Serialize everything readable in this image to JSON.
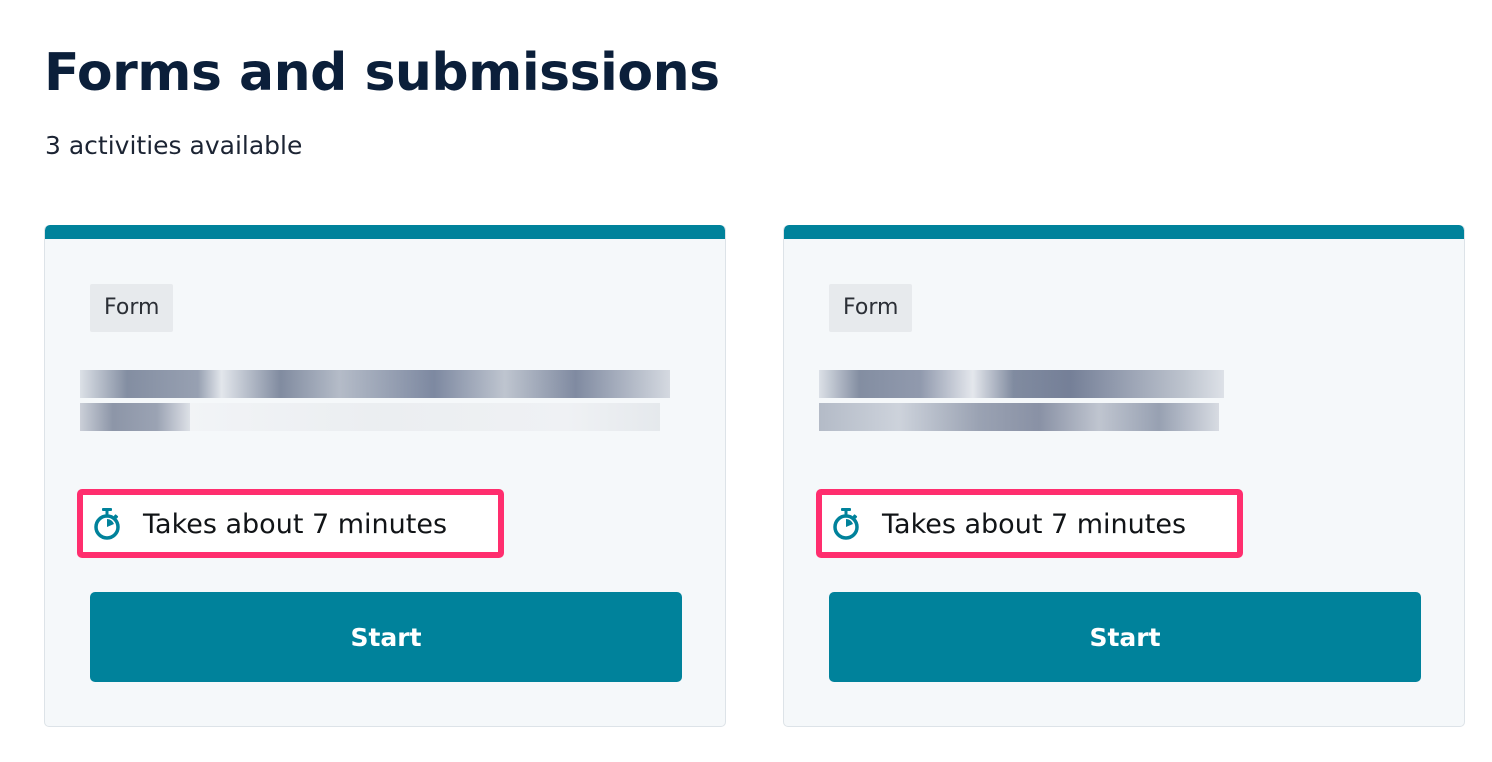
{
  "page": {
    "title": "Forms and submissions",
    "activity_count": "3 activities available"
  },
  "theme": {
    "accent_color": "#00829b",
    "highlight_color": "#ff2e6e",
    "card_background": "#f5f8fa"
  },
  "cards": [
    {
      "tag": "Form",
      "title_obscured": true,
      "duration_icon": "stopwatch-icon",
      "duration": "Takes about 7 minutes",
      "start_label": "Start"
    },
    {
      "tag": "Form",
      "title_obscured": true,
      "duration_icon": "stopwatch-icon",
      "duration": "Takes about 7 minutes",
      "start_label": "Start"
    }
  ]
}
